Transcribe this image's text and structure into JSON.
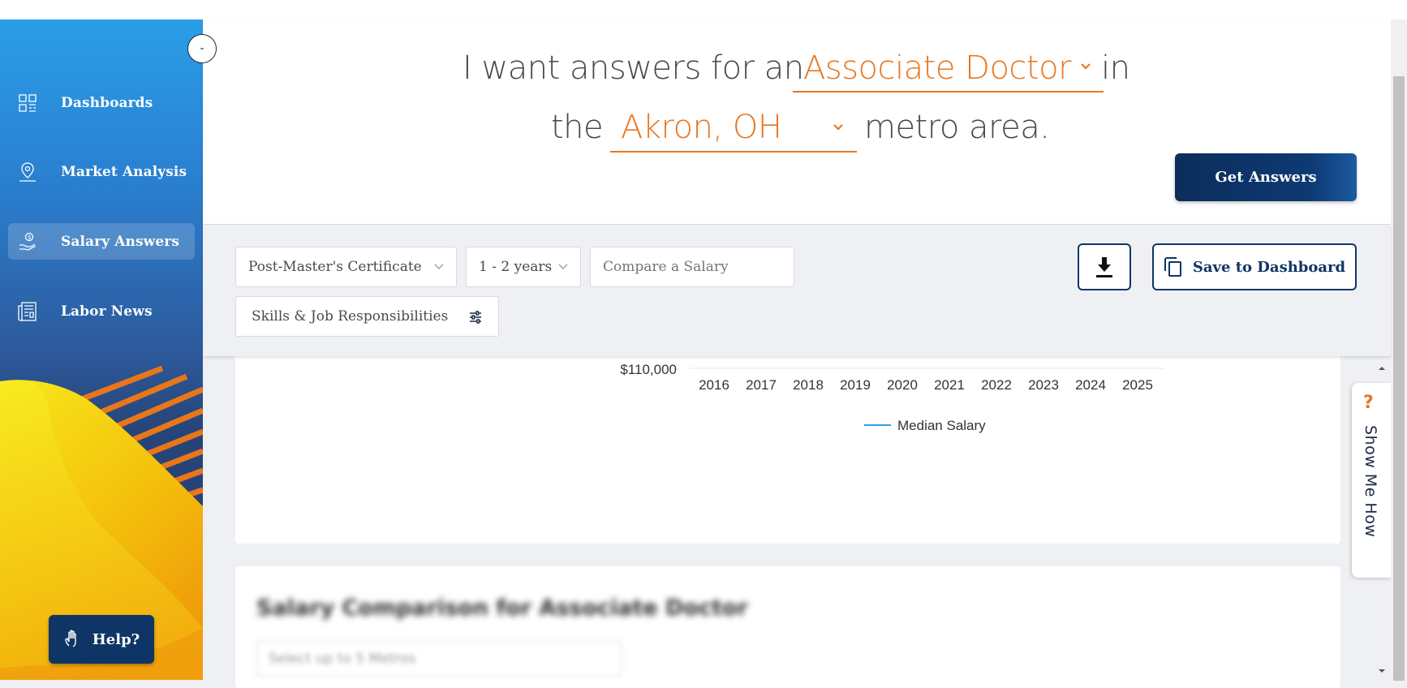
{
  "sidebar": {
    "collapse_label": "-",
    "items": [
      {
        "label": "Dashboards",
        "icon": "dashboard-grid-icon"
      },
      {
        "label": "Market Analysis",
        "icon": "map-pin-icon"
      },
      {
        "label": "Salary Answers",
        "icon": "salary-hand-icon",
        "active": true
      },
      {
        "label": "Labor News",
        "icon": "newspaper-icon"
      }
    ],
    "help_label": "Help?"
  },
  "header": {
    "sentence_prefix": "I want answers for an",
    "occupation": "Associate Doctor",
    "sentence_mid": "in",
    "the": "the",
    "location": "Akron, OH",
    "sentence_suffix": "metro area.",
    "get_answers_label": "Get Answers"
  },
  "filters": {
    "education": "Post-Master's Certificate",
    "experience": "1 - 2 years",
    "compare_placeholder": "Compare a Salary",
    "skills_label": "Skills & Job Responsibilities",
    "save_label": "Save to Dashboard"
  },
  "chart_data": {
    "type": "line",
    "x": [
      "2016",
      "2017",
      "2018",
      "2019",
      "2020",
      "2021",
      "2022",
      "2023",
      "2024",
      "2025"
    ],
    "visible_ytick": "$110,000",
    "series": [
      {
        "name": "Median Salary",
        "color": "#2a9ee8"
      }
    ],
    "legend_position": "bottom"
  },
  "card2": {
    "title": "Salary Comparison for Associate Doctor",
    "select_placeholder": "Select up to 5 Metros"
  },
  "show_me_how": {
    "icon": "?",
    "label": "Show Me How"
  },
  "colors": {
    "accent": "#e87722",
    "navy": "#0f3566",
    "series": "#2a9ee8"
  }
}
